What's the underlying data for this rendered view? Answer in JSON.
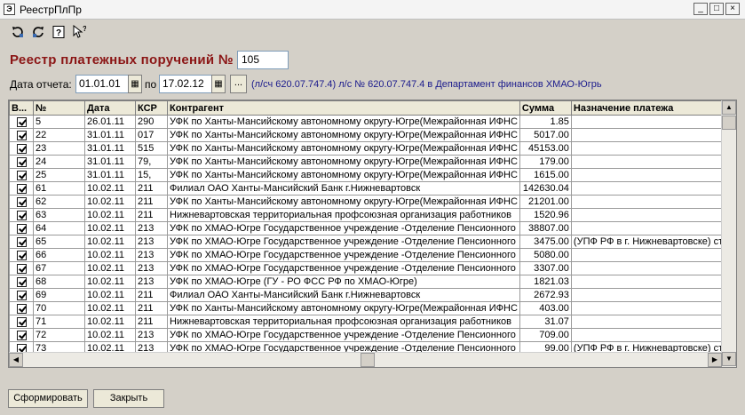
{
  "window": {
    "title": "РеестрПлПр",
    "app_icon": "Э",
    "minimize_glyph": "_",
    "maximize_glyph": "□",
    "close_glyph": "×"
  },
  "toolbar": {
    "icons": [
      "refresh-left-icon",
      "refresh-right-icon",
      "help-icon",
      "pointer-help-icon"
    ]
  },
  "header": {
    "title": "Реестр платежных поручений №",
    "number": "105",
    "date_label": "Дата отчета:",
    "date_from": "01.01.01",
    "to_label": "по",
    "date_to": "17.02.12",
    "dots_label": "...",
    "account_info": "(л/сч 620.07.747.4) л/с № 620.07.747.4 в Департамент финансов ХМАО-Югрь"
  },
  "grid": {
    "columns": [
      "В...",
      "№",
      "Дата",
      "КСР",
      "Контрагент",
      "Сумма",
      "Назначение платежа"
    ],
    "rows": [
      {
        "checked": true,
        "num": "5",
        "date": "26.01.11",
        "ksr": "290",
        "counterparty": "УФК по Ханты-Мансийскому автономному округу-Югре(Межрайонная ИФНС",
        "amount": "1.85",
        "purpose": ""
      },
      {
        "checked": true,
        "num": "22",
        "date": "31.01.11",
        "ksr": "017",
        "counterparty": "УФК по Ханты-Мансийскому автономному округу-Югре(Межрайонная ИФНС",
        "amount": "5017.00",
        "purpose": ""
      },
      {
        "checked": true,
        "num": "23",
        "date": "31.01.11",
        "ksr": "515",
        "counterparty": "УФК по Ханты-Мансийскому автономному округу-Югре(Межрайонная ИФНС",
        "amount": "45153.00",
        "purpose": ""
      },
      {
        "checked": true,
        "num": "24",
        "date": "31.01.11",
        "ksr": "79,",
        "counterparty": "УФК по Ханты-Мансийскому автономному округу-Югре(Межрайонная ИФНС",
        "amount": "179.00",
        "purpose": "",
        "selected": true
      },
      {
        "checked": true,
        "num": "25",
        "date": "31.01.11",
        "ksr": "15,",
        "counterparty": "УФК по Ханты-Мансийскому автономному округу-Югре(Межрайонная ИФНС",
        "amount": "1615.00",
        "purpose": ""
      },
      {
        "checked": true,
        "num": "61",
        "date": "10.02.11",
        "ksr": "211",
        "counterparty": "Филиал ОАО Ханты-Мансийский Банк г.Нижневартовск",
        "amount": "142630.04",
        "purpose": ""
      },
      {
        "checked": true,
        "num": "62",
        "date": "10.02.11",
        "ksr": "211",
        "counterparty": "УФК по Ханты-Мансийскому автономному округу-Югре(Межрайонная ИФНС",
        "amount": "21201.00",
        "purpose": ""
      },
      {
        "checked": true,
        "num": "63",
        "date": "10.02.11",
        "ksr": "211",
        "counterparty": "Нижневартовская территориальная профсоюзная организация работников",
        "amount": "1520.96",
        "purpose": ""
      },
      {
        "checked": true,
        "num": "64",
        "date": "10.02.11",
        "ksr": "213",
        "counterparty": "УФК по ХМАО-Югре Государственное учреждение -Отделение Пенсионного",
        "amount": "38807.00",
        "purpose": ""
      },
      {
        "checked": true,
        "num": "65",
        "date": "10.02.11",
        "ksr": "213",
        "counterparty": "УФК по ХМАО-Югре Государственное учреждение -Отделение Пенсионного",
        "amount": "3475.00",
        "purpose": "(УПФ РФ в г. Нижневартовске) ст"
      },
      {
        "checked": true,
        "num": "66",
        "date": "10.02.11",
        "ksr": "213",
        "counterparty": "УФК по ХМАО-Югре Государственное учреждение -Отделение Пенсионного",
        "amount": "5080.00",
        "purpose": ""
      },
      {
        "checked": true,
        "num": "67",
        "date": "10.02.11",
        "ksr": "213",
        "counterparty": "УФК по ХМАО-Югре Государственное учреждение -Отделение Пенсионного",
        "amount": "3307.00",
        "purpose": ""
      },
      {
        "checked": true,
        "num": "68",
        "date": "10.02.11",
        "ksr": "213",
        "counterparty": "УФК по ХМАО-Югре (ГУ - РО ФСС РФ по ХМАО-Югре)",
        "amount": "1821.03",
        "purpose": ""
      },
      {
        "checked": true,
        "num": "69",
        "date": "10.02.11",
        "ksr": "211",
        "counterparty": "Филиал ОАО Ханты-Мансийский Банк г.Нижневартовск",
        "amount": "2672.93",
        "purpose": ""
      },
      {
        "checked": true,
        "num": "70",
        "date": "10.02.11",
        "ksr": "211",
        "counterparty": "УФК по Ханты-Мансийскому автономному округу-Югре(Межрайонная ИФНС",
        "amount": "403.00",
        "purpose": ""
      },
      {
        "checked": true,
        "num": "71",
        "date": "10.02.11",
        "ksr": "211",
        "counterparty": "Нижневартовская территориальная профсоюзная организация работников",
        "amount": "31.07",
        "purpose": ""
      },
      {
        "checked": true,
        "num": "72",
        "date": "10.02.11",
        "ksr": "213",
        "counterparty": "УФК по ХМАО-Югре Государственное учреждение -Отделение Пенсионного",
        "amount": "709.00",
        "purpose": ""
      },
      {
        "checked": true,
        "num": "73",
        "date": "10.02.11",
        "ksr": "213",
        "counterparty": "УФК по ХМАО-Югре Государственное учреждение -Отделение Пенсионного",
        "amount": "99.00",
        "purpose": "(УПФ РФ в г. Нижневартовске) ст"
      }
    ]
  },
  "footer": {
    "generate_label": "Сформировать",
    "close_label": "Закрыть"
  }
}
